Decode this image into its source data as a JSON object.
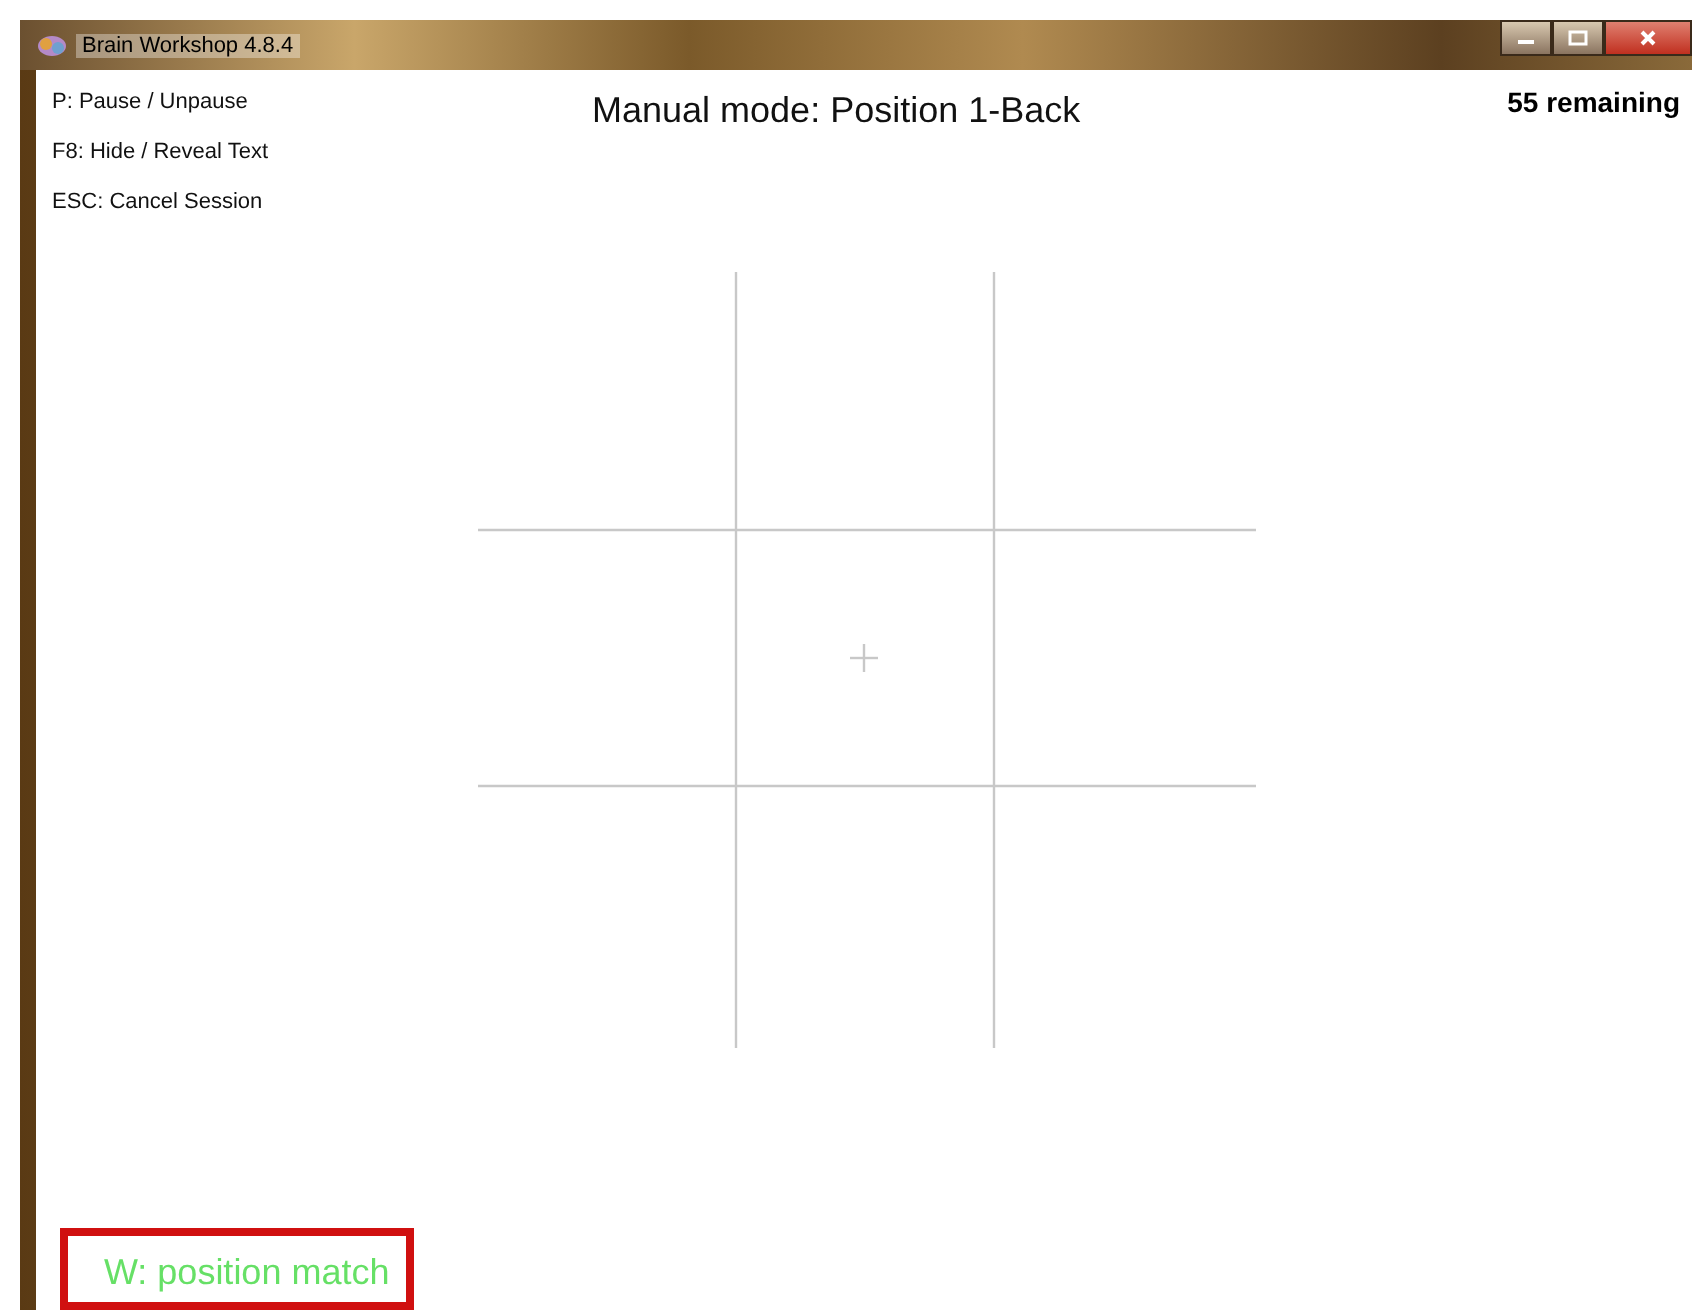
{
  "window": {
    "title": "Brain Workshop 4.8.4"
  },
  "help_lines": [
    "P: Pause / Unpause",
    "F8: Hide / Reveal Text",
    "ESC: Cancel Session"
  ],
  "mode_title": "Manual mode: Position 1-Back",
  "remaining": "55 remaining",
  "match_keys": [
    {
      "label": "W: position match",
      "selected": true
    }
  ]
}
